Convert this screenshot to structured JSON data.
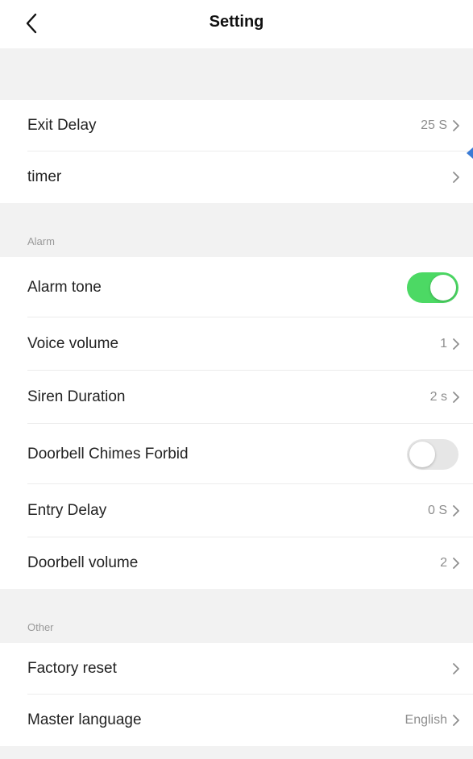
{
  "header": {
    "title": "Setting",
    "back_icon": "chevron-left-icon"
  },
  "rows_top": [
    {
      "label": "Exit Delay",
      "value": "25 S"
    },
    {
      "label": "timer",
      "value": ""
    }
  ],
  "alarm": {
    "section_title": "Alarm",
    "alarm_tone": {
      "label": "Alarm tone",
      "enabled": true
    },
    "voice_volume": {
      "label": "Voice volume",
      "value": "1"
    },
    "siren_duration": {
      "label": "Siren Duration",
      "value": "2 s"
    },
    "doorbell_chimes_forbid": {
      "label": "Doorbell Chimes Forbid",
      "enabled": false
    },
    "entry_delay": {
      "label": "Entry Delay",
      "value": "0 S"
    },
    "doorbell_volume": {
      "label": "Doorbell volume",
      "value": "2"
    }
  },
  "other": {
    "section_title": "Other",
    "factory_reset": {
      "label": "Factory reset",
      "value": ""
    },
    "master_language": {
      "label": "Master language",
      "value": "English"
    }
  },
  "colors": {
    "toggle_on": "#4cd964",
    "toggle_off": "#e6e6e6",
    "background": "#f2f2f2",
    "marker": "#3a7bd5"
  }
}
